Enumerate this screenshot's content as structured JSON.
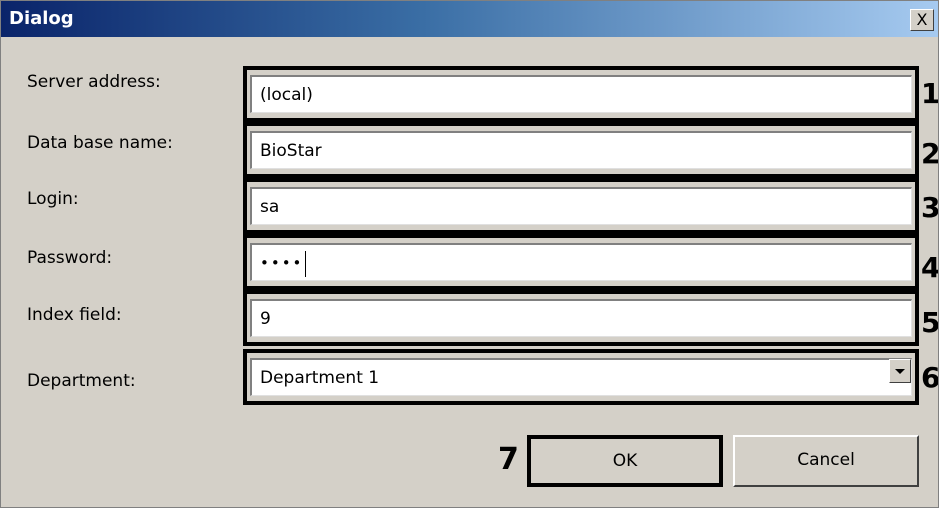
{
  "dialog": {
    "title": "Dialog",
    "close_label": "X"
  },
  "fields": {
    "server_address": {
      "label": "Server address:",
      "value": "(local)",
      "marker": "1"
    },
    "database_name": {
      "label": "Data base name:",
      "value": "BioStar",
      "marker": "2"
    },
    "login": {
      "label": "Login:",
      "value": "sa",
      "marker": "3"
    },
    "password": {
      "label": "Password:",
      "value": "••••",
      "marker": "4"
    },
    "index_field": {
      "label": "Index field:",
      "value": "9",
      "marker": "5"
    },
    "department": {
      "label": "Department:",
      "value": "Department 1",
      "marker": "6"
    }
  },
  "buttons": {
    "ok_label": "OK",
    "ok_marker": "7",
    "cancel_label": "Cancel"
  }
}
